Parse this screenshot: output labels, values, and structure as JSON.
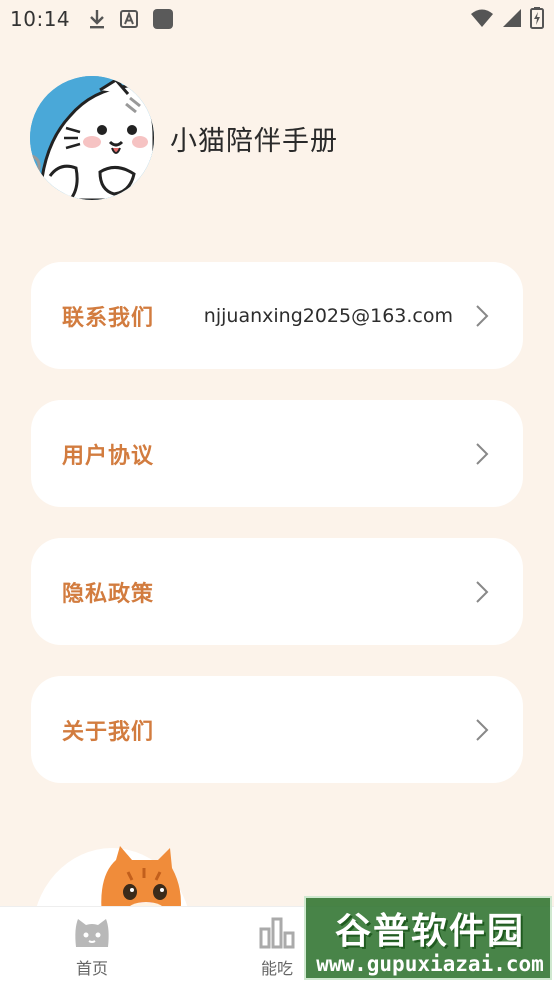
{
  "status_bar": {
    "time": "10:14",
    "icons": [
      "download-icon",
      "a-icon",
      "square-icon",
      "wifi-icon",
      "signal-icon",
      "battery-icon"
    ]
  },
  "profile": {
    "app_name": "小猫陪伴手册"
  },
  "menu": [
    {
      "label": "联系我们",
      "value": "njjuanxing2025@163.com"
    },
    {
      "label": "用户协议",
      "value": ""
    },
    {
      "label": "隐私政策",
      "value": ""
    },
    {
      "label": "关于我们",
      "value": ""
    }
  ],
  "bottom_nav": [
    {
      "label": "首页",
      "icon": "cat-face-icon"
    },
    {
      "label": "能吃",
      "icon": "bar-chart-icon"
    }
  ],
  "watermark": {
    "title": "谷普软件园",
    "url": "www.gupuxiazai.com"
  },
  "colors": {
    "background": "#fcf3ea",
    "accent": "#d27c3f",
    "card": "#ffffff"
  }
}
